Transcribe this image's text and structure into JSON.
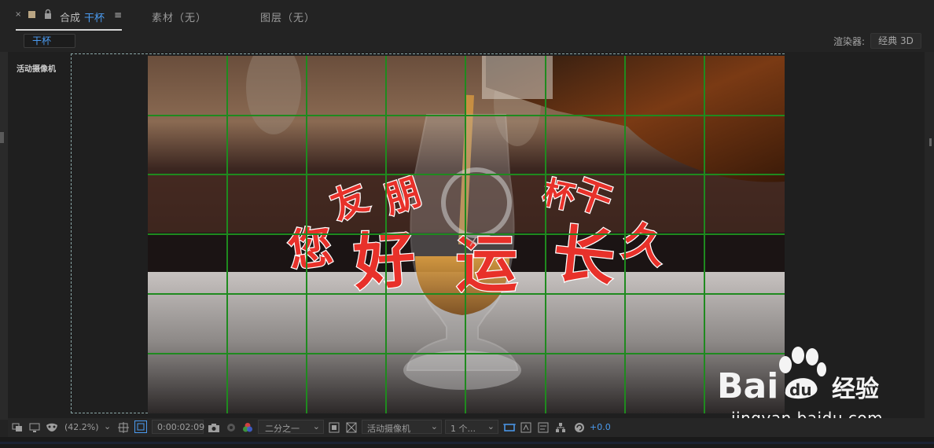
{
  "tabs": {
    "close": "×",
    "comp_label": "合成",
    "comp_name": "干杯",
    "menu": "≡",
    "footage": "素材（无）",
    "layer": "图层（无）"
  },
  "header": {
    "comp_chip": "干杯",
    "renderer_label": "渲染器:",
    "renderer_value": "经典 3D"
  },
  "viewer": {
    "camera_label": "活动摄像机",
    "overlay_text": [
      "您",
      "好",
      "运",
      "长",
      "久",
      "朋",
      "友",
      "干",
      "杯"
    ]
  },
  "toolbar": {
    "zoom": "(42.2%)",
    "timecode": "0:00:02:09",
    "resolution": "二分之一",
    "camera": "活动摄像机",
    "views": "1 个...",
    "exposure": "+0.0"
  },
  "watermark": {
    "brand_bai": "Bai",
    "brand_du": "经验",
    "url": "jingyan.baidu.com"
  },
  "colors": {
    "accent_blue": "#4b9bf0",
    "grid_green": "#1f8a1f",
    "text_red": "#e8312a"
  }
}
